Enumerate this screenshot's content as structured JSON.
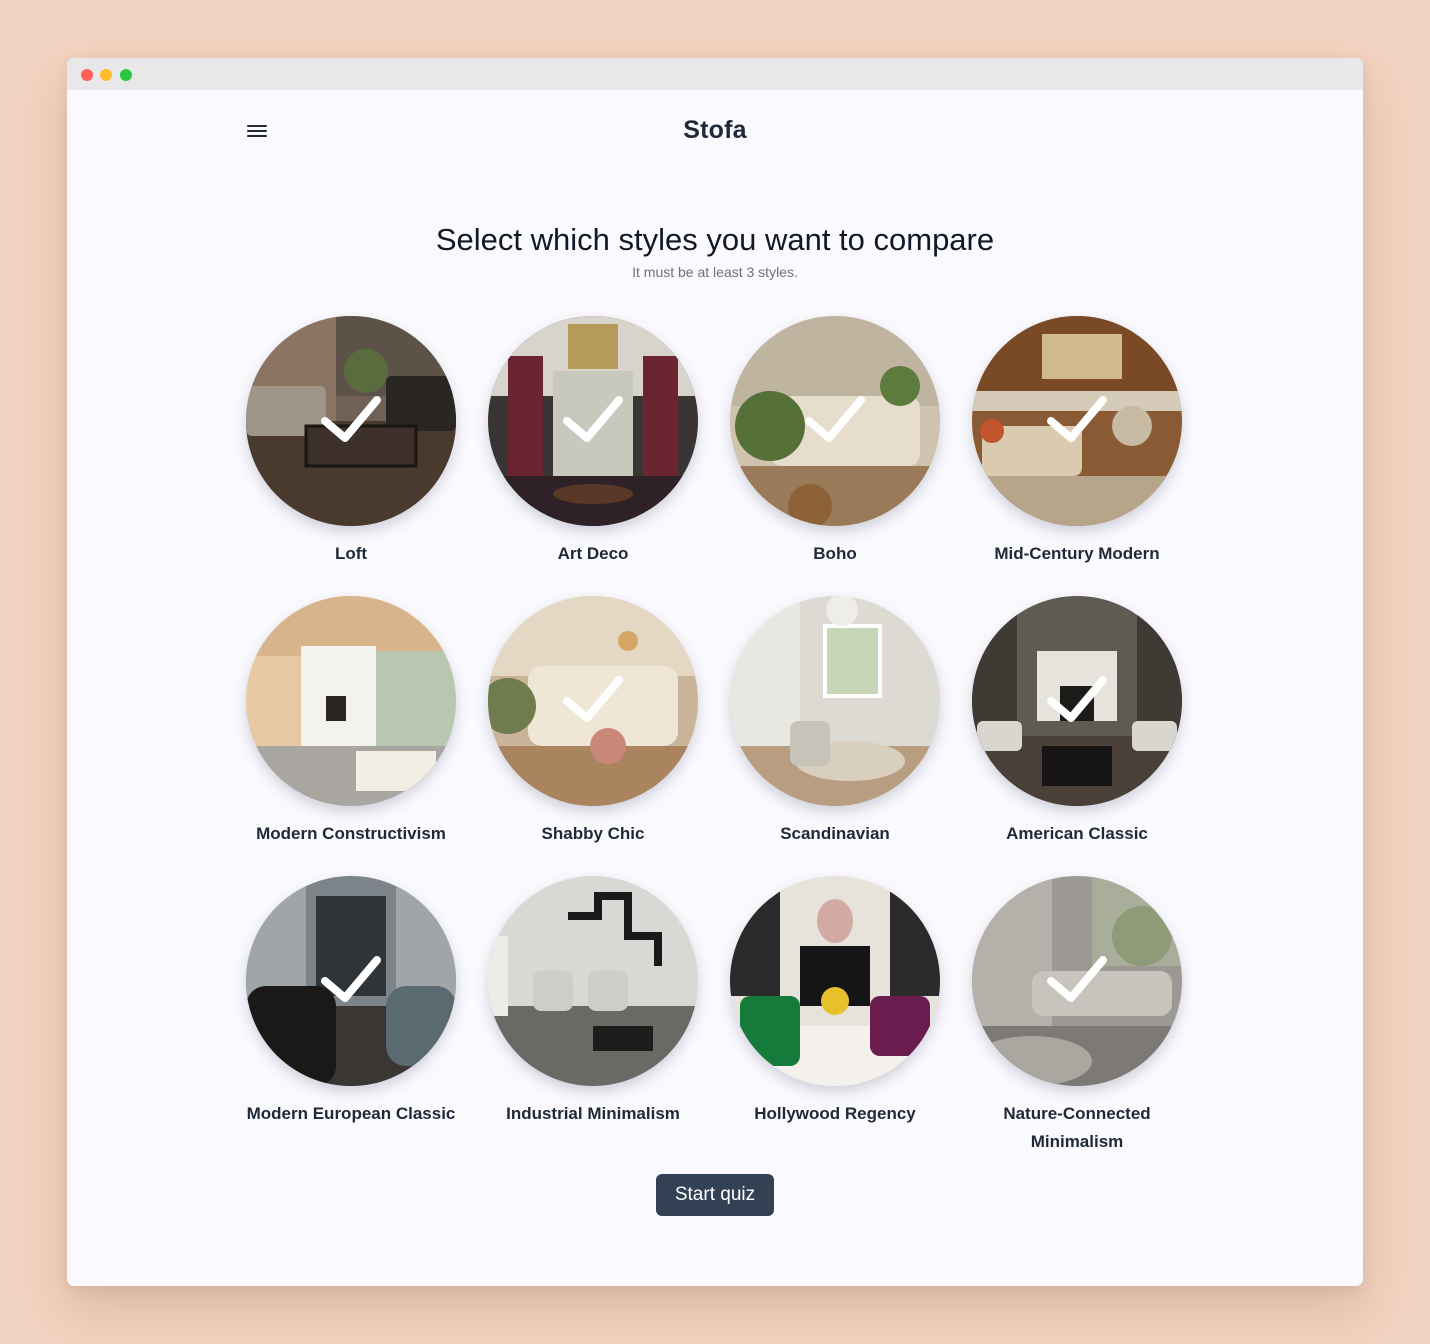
{
  "header": {
    "brand": "Stofa",
    "menu_icon": "hamburger-menu-icon"
  },
  "main": {
    "title": "Select which styles you want to compare",
    "subtitle": "It must be at least 3 styles.",
    "styles": [
      {
        "label": "Loft",
        "selected": true
      },
      {
        "label": "Art Deco",
        "selected": true
      },
      {
        "label": "Boho",
        "selected": true
      },
      {
        "label": "Mid-Century Modern",
        "selected": true
      },
      {
        "label": "Modern Constructivism",
        "selected": false
      },
      {
        "label": "Shabby Chic",
        "selected": true
      },
      {
        "label": "Scandinavian",
        "selected": false
      },
      {
        "label": "American Classic",
        "selected": true
      },
      {
        "label": "Modern European Classic",
        "selected": true
      },
      {
        "label": "Industrial Minimalism",
        "selected": false
      },
      {
        "label": "Hollywood Regency",
        "selected": false
      },
      {
        "label": "Nature-Connected Minimalism",
        "selected": true
      }
    ],
    "start_button": "Start quiz"
  },
  "colors": {
    "background": "#f2d2c0",
    "window": "#fafafe",
    "button": "#334155",
    "text": "#1f2937"
  }
}
